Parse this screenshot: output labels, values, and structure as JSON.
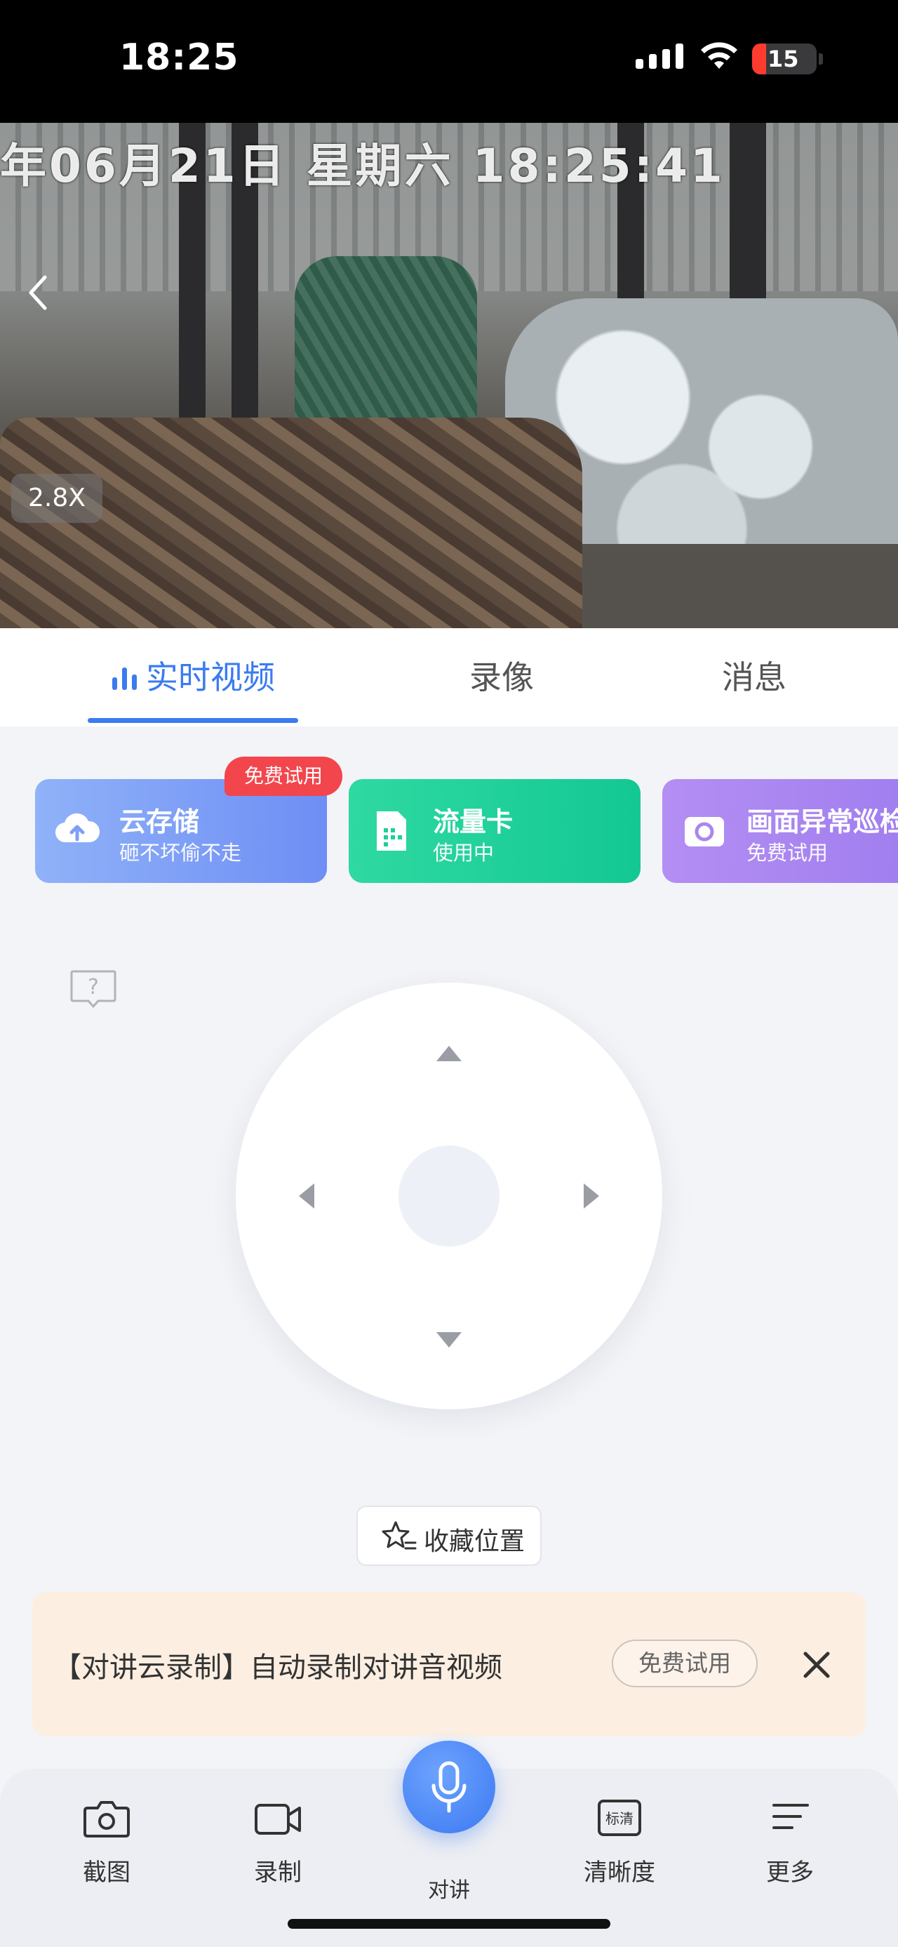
{
  "status_bar": {
    "time": "18:25",
    "battery": "15"
  },
  "video": {
    "osd_text": "年06月21日  星期六  18:25:41",
    "zoom": "2.8X"
  },
  "tabs": [
    {
      "label": "实时视频",
      "active": true
    },
    {
      "label": "录像",
      "active": false
    },
    {
      "label": "消息",
      "active": false
    }
  ],
  "service_cards": [
    {
      "title": "云存储",
      "subtitle": "砸不坏偷不走",
      "badge": "免费试用",
      "icon": "cloud-upload-icon",
      "color": "#7f9ff6"
    },
    {
      "title": "流量卡",
      "subtitle": "使用中",
      "icon": "sim-card-icon",
      "color": "#1fcf9a"
    },
    {
      "title": "画面异常巡检",
      "subtitle": "免费试用",
      "icon": "camera-frame-icon",
      "color": "#a986f0"
    }
  ],
  "favorite": {
    "label": "收藏位置"
  },
  "promo": {
    "text": "【对讲云录制】自动录制对讲音视频",
    "button": "免费试用"
  },
  "toolbar": {
    "screenshot": "截图",
    "record": "录制",
    "talk": "对讲",
    "quality": "清晰度",
    "quality_icon_text": "标清",
    "more": "更多"
  },
  "colors": {
    "accent": "#3a7bf0",
    "badge_red": "#f2454c",
    "promo_bg": "#fcefe2"
  }
}
